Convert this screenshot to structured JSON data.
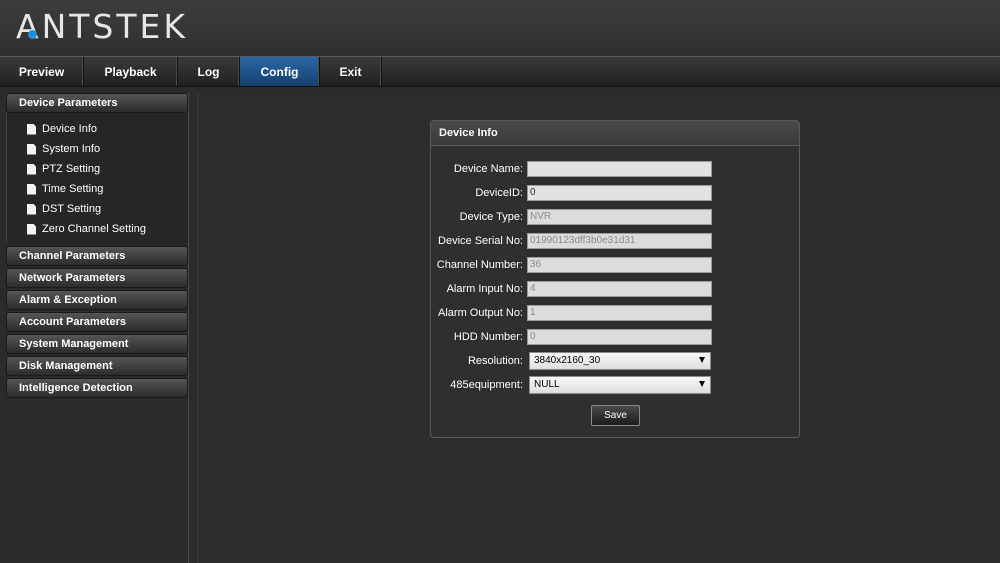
{
  "brand": {
    "logo_text": "ANTSTEK",
    "accent_color": "#1e90d8"
  },
  "nav": {
    "tabs": [
      {
        "label": "Preview"
      },
      {
        "label": "Playback"
      },
      {
        "label": "Log"
      },
      {
        "label": "Config"
      },
      {
        "label": "Exit"
      }
    ],
    "active": "Config"
  },
  "sidebar": {
    "groups": [
      {
        "label": "Device Parameters",
        "open": true,
        "items": [
          {
            "label": "Device Info",
            "icon": "document-icon"
          },
          {
            "label": "System Info",
            "icon": "document-icon"
          },
          {
            "label": "PTZ Setting",
            "icon": "document-icon"
          },
          {
            "label": "Time Setting",
            "icon": "document-icon"
          },
          {
            "label": "DST Setting",
            "icon": "document-icon"
          },
          {
            "label": "Zero Channel Setting",
            "icon": "document-icon"
          }
        ]
      },
      {
        "label": "Channel Parameters"
      },
      {
        "label": "Network Parameters"
      },
      {
        "label": "Alarm & Exception"
      },
      {
        "label": "Account Parameters"
      },
      {
        "label": "System Management"
      },
      {
        "label": "Disk Management"
      },
      {
        "label": "Intelligence Detection"
      }
    ]
  },
  "panel": {
    "title": "Device Info",
    "fields": {
      "device_name": {
        "label": "Device Name:",
        "value": ""
      },
      "device_id": {
        "label": "DeviceID:",
        "value": "0"
      },
      "device_type": {
        "label": "Device Type:",
        "value": "NVR"
      },
      "serial_no": {
        "label": "Device Serial No:",
        "value": "01990123dff3b0e31d31"
      },
      "channel_number": {
        "label": "Channel Number:",
        "value": "36"
      },
      "alarm_input": {
        "label": "Alarm Input No:",
        "value": "4"
      },
      "alarm_output": {
        "label": "Alarm Output No:",
        "value": "1"
      },
      "hdd_number": {
        "label": "HDD Number:",
        "value": "0"
      },
      "resolution": {
        "label": "Resolution:",
        "value": "3840x2160_30"
      },
      "equipment_485": {
        "label": "485equipment:",
        "value": "NULL"
      }
    },
    "save_label": "Save"
  }
}
